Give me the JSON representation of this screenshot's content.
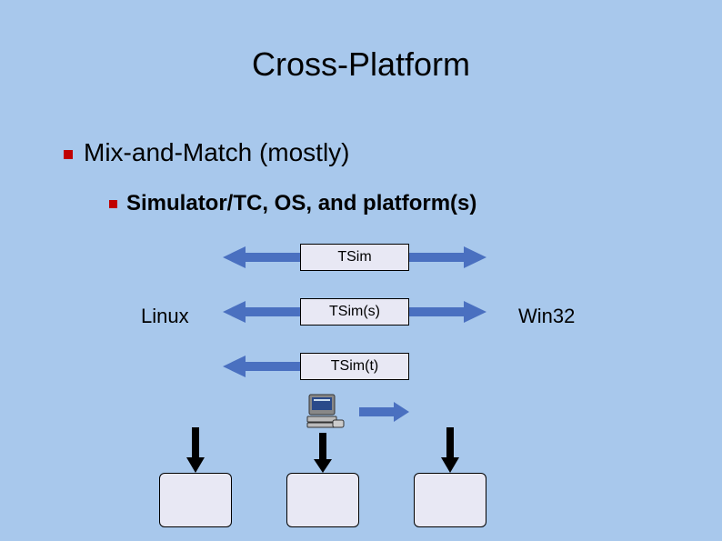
{
  "title": "Cross-Platform",
  "bullets": {
    "level1": "Mix-and-Match (mostly)",
    "level2": "Simulator/TC, OS, and platform(s)"
  },
  "boxes": {
    "tsim": "TSim",
    "tsims": "TSim(s)",
    "tsimt": "TSim(t)"
  },
  "labels": {
    "linux": "Linux",
    "win32": "Win32"
  },
  "colors": {
    "arrow": "#4a70c0",
    "bullet": "#c00000",
    "box_fill": "#e8e8f4"
  }
}
